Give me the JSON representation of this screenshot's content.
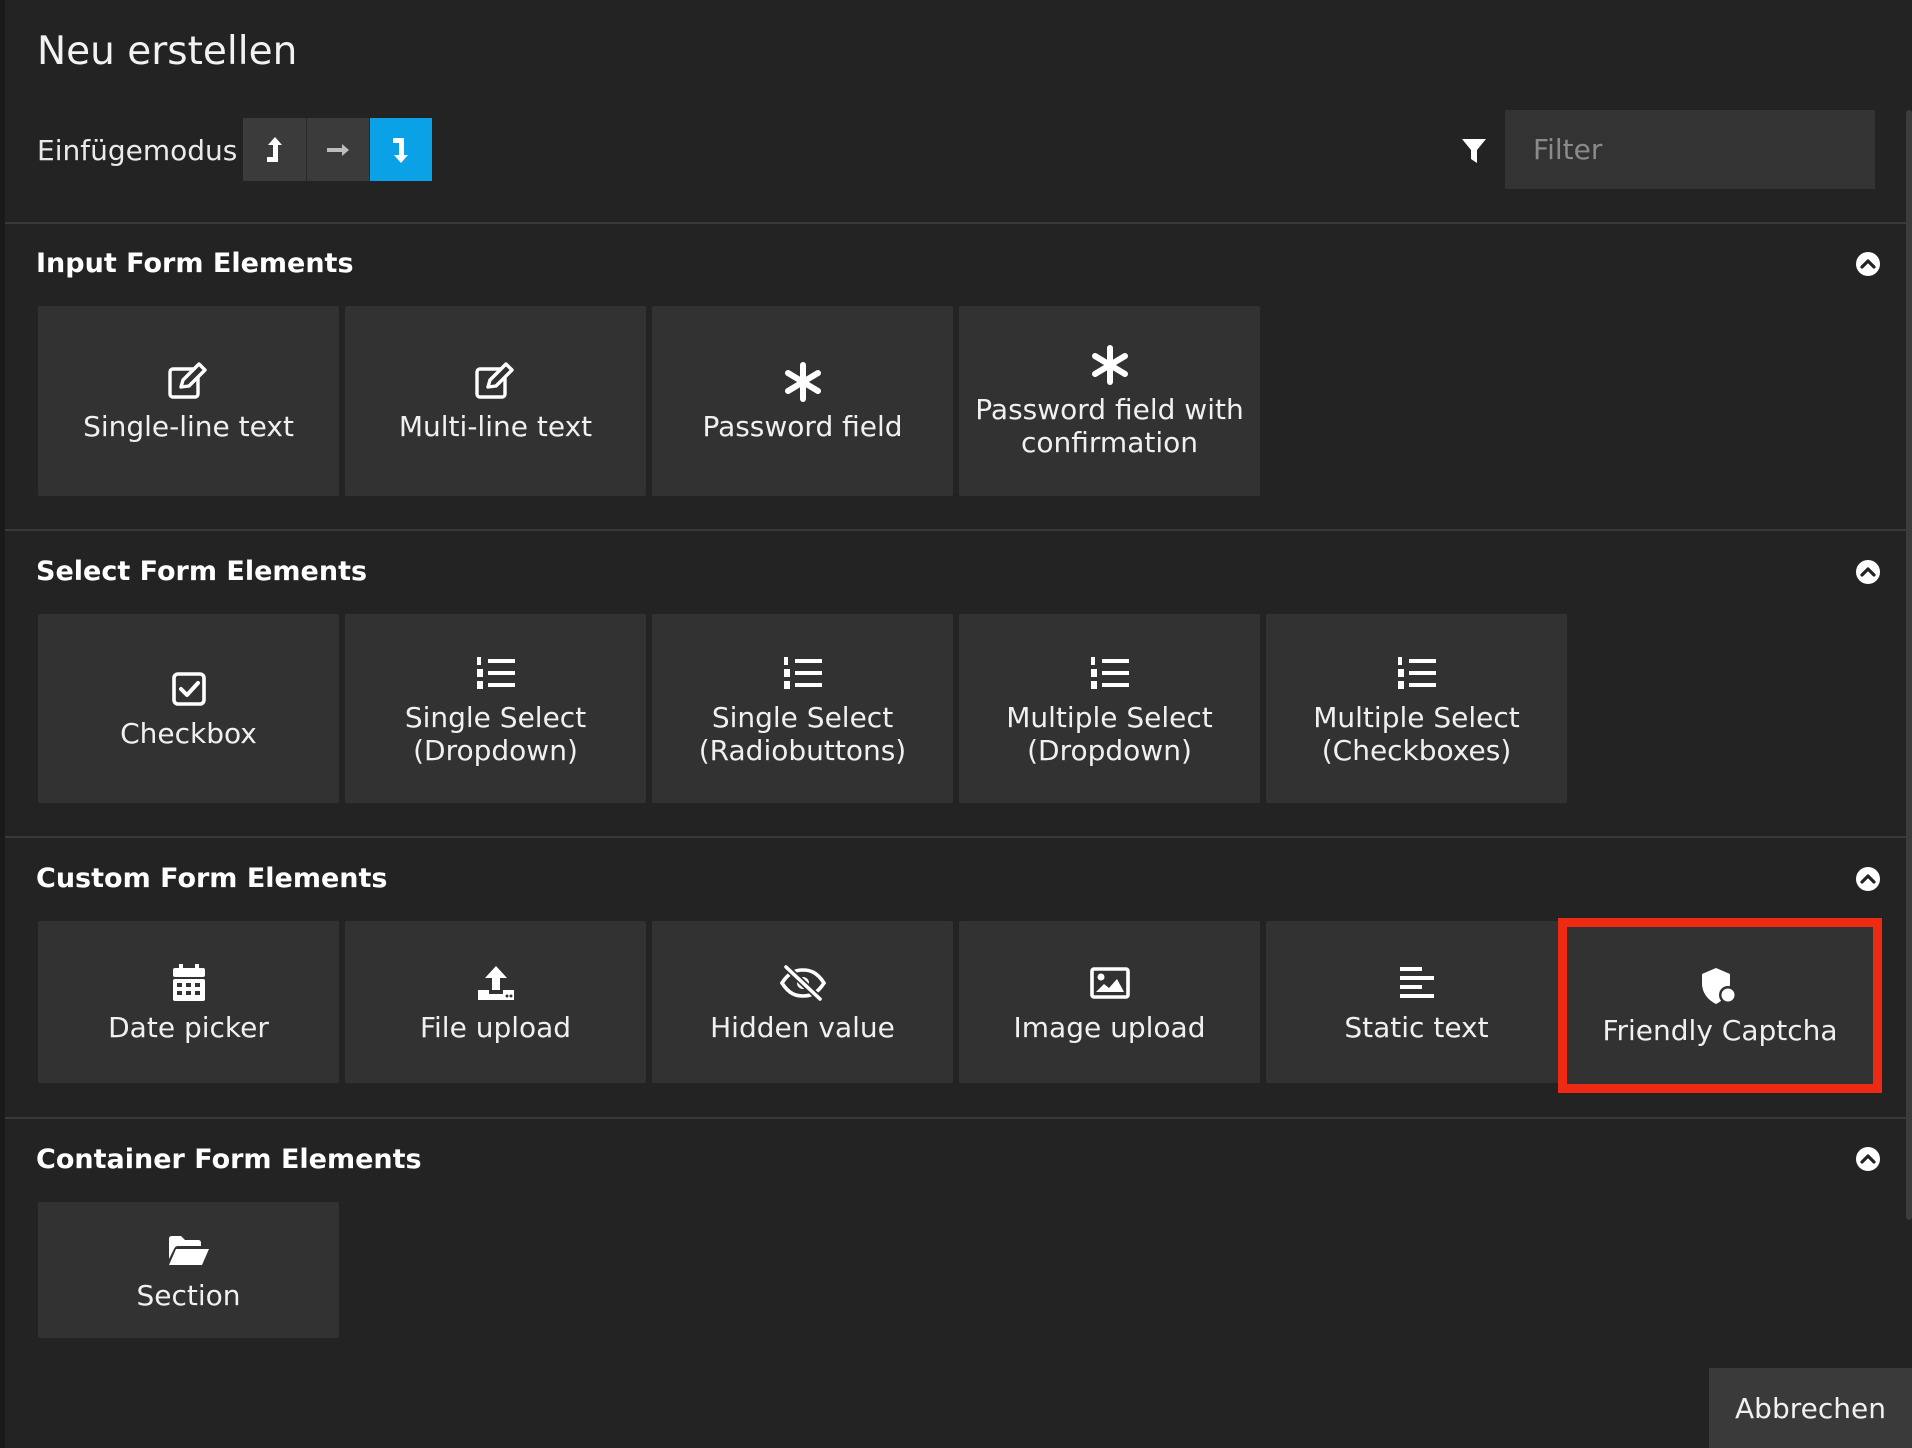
{
  "header": {
    "title": "Neu erstellen",
    "insert_mode_label": "Einfügemodus",
    "filter_placeholder": "Filter"
  },
  "insert_modes": [
    {
      "name": "insert-before",
      "icon": "arrow-up-icon",
      "active": false
    },
    {
      "name": "insert-inside",
      "icon": "arrow-right-icon",
      "active": false
    },
    {
      "name": "insert-after",
      "icon": "arrow-down-icon",
      "active": true
    }
  ],
  "colors": {
    "background": "#232323",
    "tile": "#323232",
    "accent": "#0aa1e6",
    "highlight": "#ee2a12"
  },
  "groups": [
    {
      "title": "Input Form Elements",
      "items": [
        {
          "label": "Single-line text",
          "icon": "edit-icon"
        },
        {
          "label": "Multi-line text",
          "icon": "edit-icon"
        },
        {
          "label": "Password field",
          "icon": "asterisk-icon"
        },
        {
          "label": "Password field with confirmation",
          "icon": "asterisk-icon"
        }
      ]
    },
    {
      "title": "Select Form Elements",
      "items": [
        {
          "label": "Checkbox",
          "icon": "checkbox-icon"
        },
        {
          "label": "Single Select (Dropdown)",
          "icon": "numbered-list-icon"
        },
        {
          "label": "Single Select (Radiobuttons)",
          "icon": "numbered-list-icon"
        },
        {
          "label": "Multiple Select (Dropdown)",
          "icon": "numbered-list-icon"
        },
        {
          "label": "Multiple Select (Checkboxes)",
          "icon": "numbered-list-icon"
        }
      ]
    },
    {
      "title": "Custom Form Elements",
      "items": [
        {
          "label": "Date picker",
          "icon": "calendar-icon"
        },
        {
          "label": "File upload",
          "icon": "upload-icon"
        },
        {
          "label": "Hidden value",
          "icon": "eye-slash-icon"
        },
        {
          "label": "Image upload",
          "icon": "image-icon"
        },
        {
          "label": "Static text",
          "icon": "align-left-icon"
        },
        {
          "label": "Friendly Captcha",
          "icon": "shield-icon",
          "highlighted": true
        }
      ]
    },
    {
      "title": "Container Form Elements",
      "items": [
        {
          "label": "Section",
          "icon": "folder-open-icon"
        }
      ]
    }
  ],
  "footer": {
    "cancel_label": "Abbrechen"
  }
}
